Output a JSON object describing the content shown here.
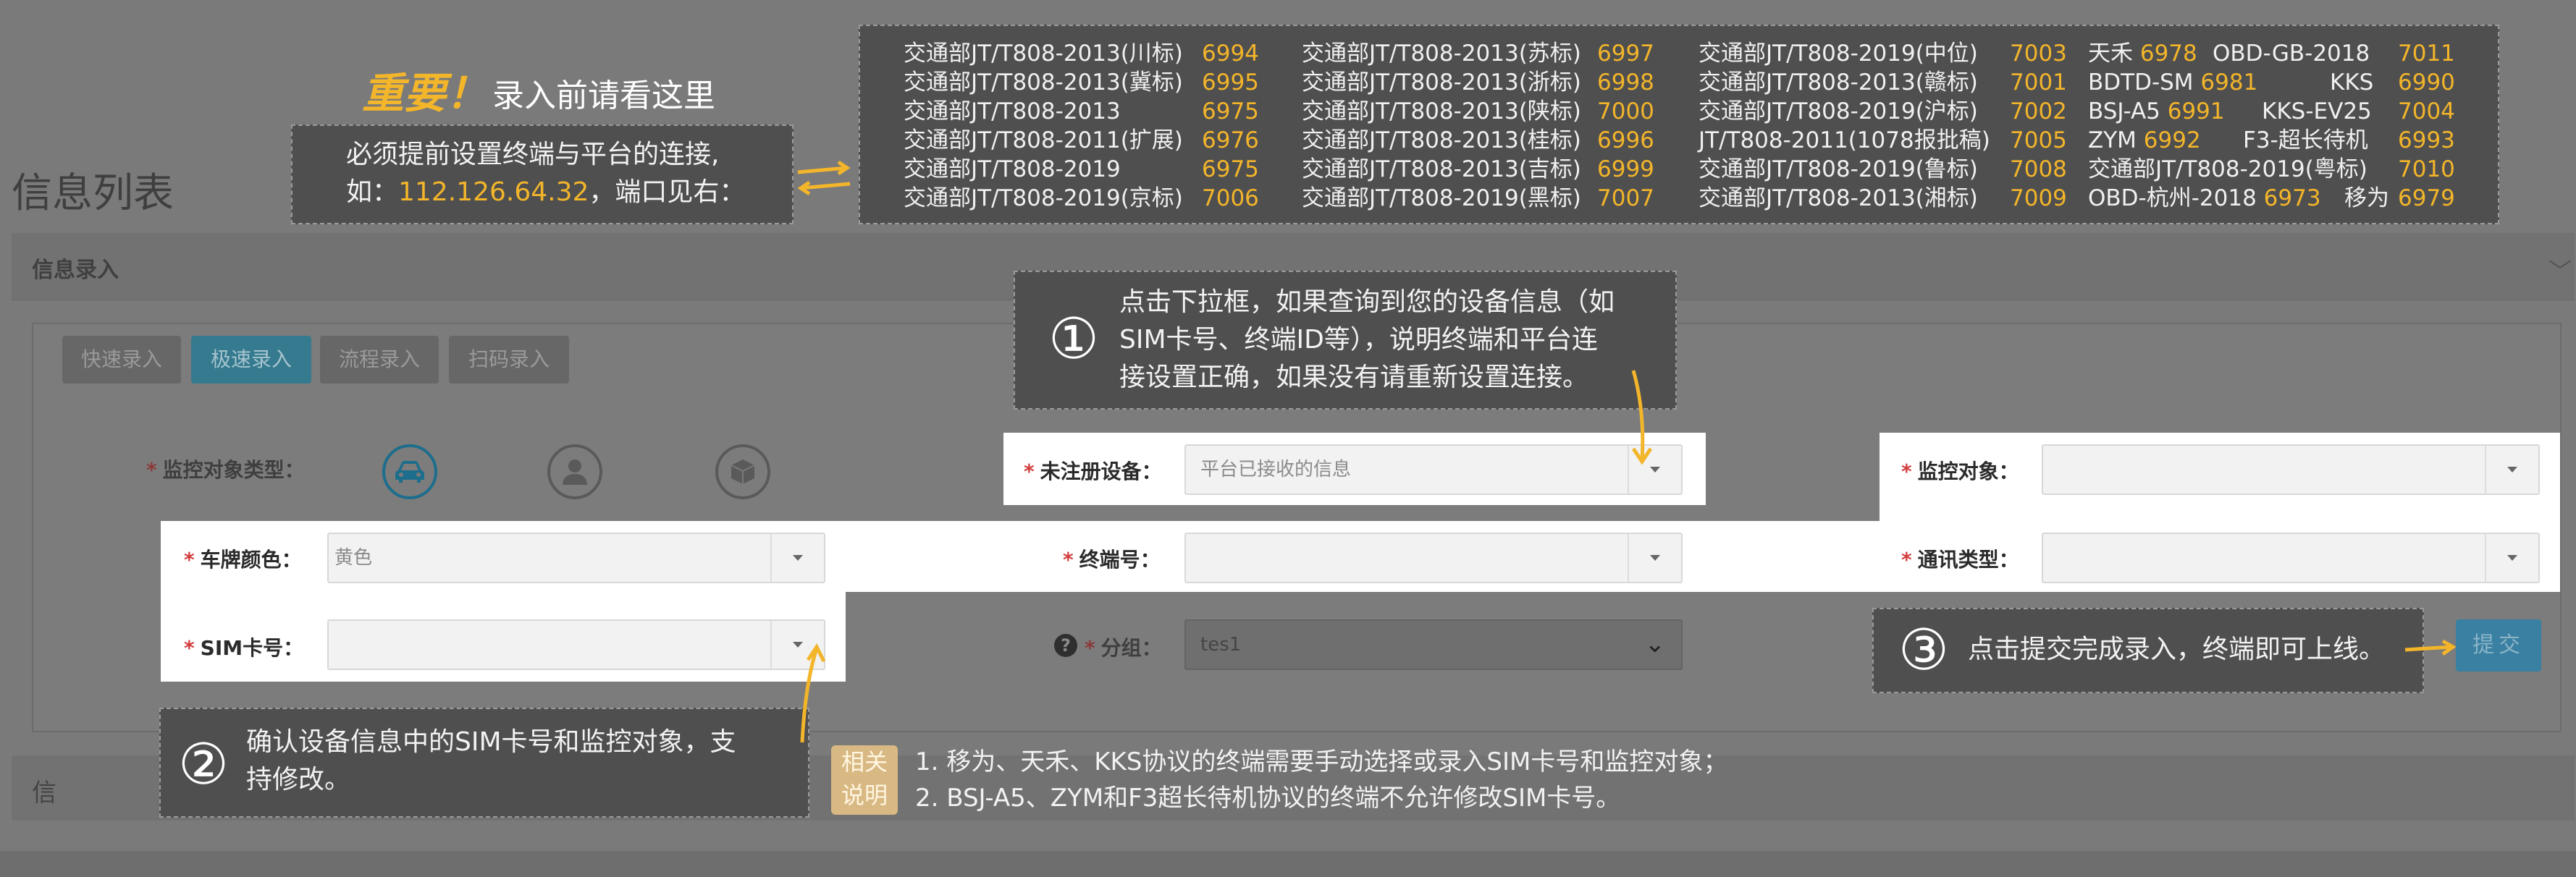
{
  "page": {
    "title": "信息列表",
    "section_title": "信息录入",
    "lower_section_title": "信"
  },
  "tabs": [
    "快速录入",
    "极速录入",
    "流程录入",
    "扫码录入"
  ],
  "form": {
    "monitor_type_label": "监控对象类型：",
    "unregistered_label": "未注册设备：",
    "unregistered_placeholder": "平台已接收的信息",
    "monitor_object_label": "监控对象：",
    "plate_color_label": "车牌颜色：",
    "plate_color_value": "黄色",
    "terminal_no_label": "终端号：",
    "comm_type_label": "通讯类型：",
    "sim_label": "SIM卡号：",
    "group_label": "分组：",
    "group_value": "tes1",
    "submit_label": "提交"
  },
  "annotations": {
    "important_title": "重要！",
    "important_sub": "录入前请看这里",
    "connection_line1": "必须提前设置终端与平台的连接,",
    "connection_line2_prefix": "如：",
    "connection_ip": "112.126.64.32",
    "connection_line2_suffix": "，端口见右：",
    "step1_num": "①",
    "step1_lines": [
      "点击下拉框，如果查询到您的设备信息（如",
      "SIM卡号、终端ID等），说明终端和平台连",
      "接设置正确，如果没有请重新设置连接。"
    ],
    "step2_num": "②",
    "step2_lines": [
      "确认设备信息中的SIM卡号和监控对象，支",
      "持修改。"
    ],
    "step3_num": "③",
    "step3_text": "点击提交完成录入，终端即可上线。",
    "related_badge": [
      "相关",
      "说明"
    ],
    "related_lines": [
      "1. 移为、天禾、KKS协议的终端需要手动选择或录入SIM卡号和监控对象；",
      "2. BSJ-A5、ZYM和F3超长待机协议的终端不允许修改SIM卡号。"
    ]
  },
  "protocols": {
    "col1": [
      {
        "name": "交通部JT/T808-2013(川标)",
        "port": "6994"
      },
      {
        "name": "交通部JT/T808-2013(冀标)",
        "port": "6995"
      },
      {
        "name": "交通部JT/T808-2013",
        "port": "6975"
      },
      {
        "name": "交通部JT/T808-2011(扩展)",
        "port": "6976"
      },
      {
        "name": "交通部JT/T808-2019",
        "port": "6975"
      },
      {
        "name": "交通部JT/T808-2019(京标)",
        "port": "7006"
      }
    ],
    "col2": [
      {
        "name": "交通部JT/T808-2013(苏标)",
        "port": "6997"
      },
      {
        "name": "交通部JT/T808-2013(浙标)",
        "port": "6998"
      },
      {
        "name": "交通部JT/T808-2013(陕标)",
        "port": "7000"
      },
      {
        "name": "交通部JT/T808-2013(桂标)",
        "port": "6996"
      },
      {
        "name": "交通部JT/T808-2013(吉标)",
        "port": "6999"
      },
      {
        "name": "交通部JT/T808-2019(黑标)",
        "port": "7007"
      }
    ],
    "col3": [
      {
        "name": "交通部JT/T808-2019(中位)",
        "port": "7003"
      },
      {
        "name": "交通部JT/T808-2013(赣标)",
        "port": "7001"
      },
      {
        "name": "交通部JT/T808-2019(沪标)",
        "port": "7002"
      },
      {
        "name": "JT/T808-2011(1078报批稿)",
        "port": "7005"
      },
      {
        "name": "交通部JT/T808-2019(鲁标)",
        "port": "7008"
      },
      {
        "name": "交通部JT/T808-2013(湘标)",
        "port": "7009"
      }
    ],
    "col4": [
      {
        "a": "天禾",
        "ap": "6978",
        "b": "OBD-GB-2018",
        "bp": "7011"
      },
      {
        "a": "BDTD-SM",
        "ap": "6981",
        "b": "KKS",
        "bp": "6990"
      },
      {
        "a": "BSJ-A5",
        "ap": "6991",
        "b": "KKS-EV25",
        "bp": "7004"
      },
      {
        "a": "ZYM",
        "ap": "6992",
        "b": "F3-超长待机",
        "bp": "6993"
      },
      {
        "a": "交通部JT/T808-2019(粤标)",
        "ap": "7010",
        "b": "",
        "bp": ""
      },
      {
        "a": "OBD-杭州-2018",
        "ap": "6973",
        "b": "移为",
        "bp": "6979"
      }
    ]
  },
  "colors": {
    "accent_yellow": "#f3b52a",
    "overlay_box": "#4f4f4f",
    "active_tab": "#357a8e",
    "required_star": "#d23d3d"
  }
}
